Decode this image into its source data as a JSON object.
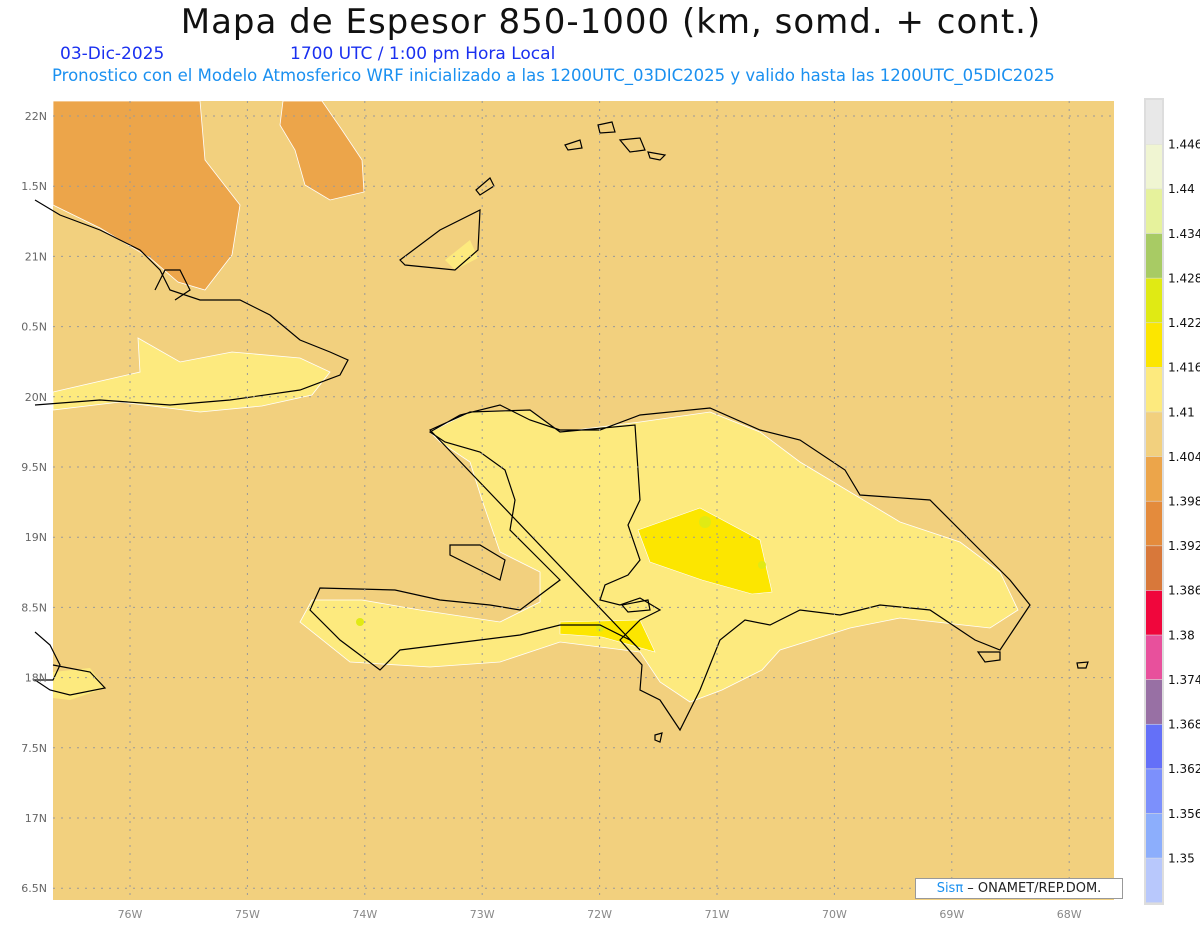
{
  "header": {
    "title": "Mapa de Espesor 850-1000 (km, somd. + cont.)",
    "date": "03-Dic-2025",
    "time": "1700 UTC / 1:00 pm Hora Local",
    "subtitle": "Pronostico con el Modelo Atmosferico WRF inicializado a las 1200UTC_03DIC2025 y valido hasta las  1200UTC_05DIC2025"
  },
  "map": {
    "background_color": "#f2d07e",
    "lat_labels": [
      "22N",
      "1.5N",
      "21N",
      "0.5N",
      "20N",
      "9.5N",
      "19N",
      "8.5N",
      "18N",
      "7.5N",
      "17N",
      "6.5N"
    ],
    "lon_labels": [
      "76W",
      "75W",
      "74W",
      "73W",
      "72W",
      "71W",
      "70W",
      "69W",
      "68W"
    ]
  },
  "colorbar": {
    "labels": [
      "1.446",
      "1.44",
      "1.434",
      "1.428",
      "1.422",
      "1.416",
      "1.41",
      "1.404",
      "1.398",
      "1.392",
      "1.386",
      "1.38",
      "1.374",
      "1.368",
      "1.362",
      "1.356",
      "1.35"
    ],
    "colors": [
      "#e8e8e8",
      "#f0f5d2",
      "#e6f29c",
      "#a8cb64",
      "#e0ea14",
      "#fce600",
      "#fdea7e",
      "#f2d07e",
      "#eca54a",
      "#e48b3c",
      "#d8783a",
      "#f0063c",
      "#e8509c",
      "#9870a4",
      "#6470f8",
      "#7c90fc",
      "#8caefc",
      "#b8c8fc"
    ]
  },
  "credit": {
    "brand": "Sisπ",
    "text": " – ONAMET/REP.DOM."
  }
}
